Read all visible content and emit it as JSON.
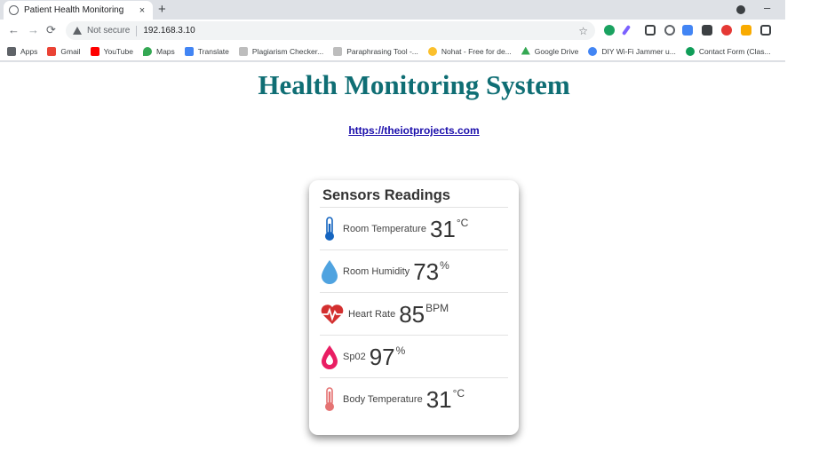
{
  "browser": {
    "tab_title": "Patient Health Monitoring",
    "tab_close": "×",
    "new_tab": "+",
    "security_label": "Not secure",
    "url": "192.168.3.10",
    "bookmarks": [
      "Apps",
      "Gmail",
      "YouTube",
      "Maps",
      "Translate",
      "Plagiarism Checker...",
      "Paraphrasing Tool -...",
      "Nohat - Free for de...",
      "Google Drive",
      "DIY Wi-Fi Jammer u...",
      "Contact Form (Clas..."
    ]
  },
  "page": {
    "title": "Health Monitoring System",
    "link": "https://theiotprojects.com"
  },
  "card": {
    "heading": "Sensors Readings",
    "readings": [
      {
        "label": "Room Temperature",
        "value": "31",
        "unit": "°C",
        "icon": "thermometer-icon",
        "color": "#1565c0"
      },
      {
        "label": "Room Humidity",
        "value": "73",
        "unit": "%",
        "icon": "water-drop-icon",
        "color": "#4fa3e0"
      },
      {
        "label": "Heart Rate",
        "value": "85",
        "unit": "BPM",
        "icon": "heartbeat-icon",
        "color": "#d32f2f"
      },
      {
        "label": "Sp02",
        "value": "97",
        "unit": "%",
        "icon": "blood-drop-icon",
        "color": "#e91e63"
      },
      {
        "label": "Body Temperature",
        "value": "31",
        "unit": "°C",
        "icon": "thermometer-icon",
        "color": "#e57373"
      }
    ]
  },
  "colors": {
    "title": "#0f6e74",
    "link": "#1a0dab"
  }
}
